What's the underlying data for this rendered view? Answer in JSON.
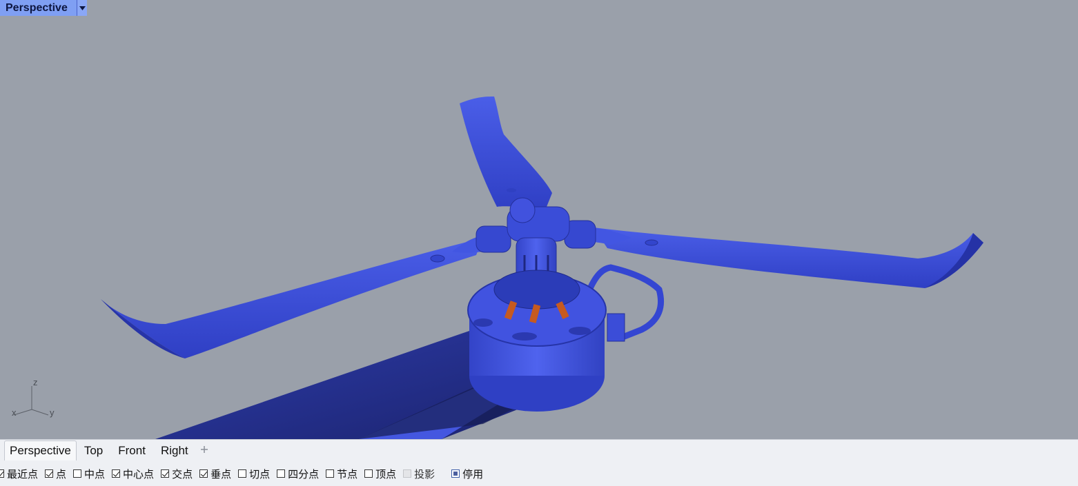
{
  "viewport": {
    "title": "Perspective",
    "dropdown_icon": "caret-down-icon",
    "background_color": "#9aa0aa",
    "model_color": "#3c4fd6",
    "axis_labels": {
      "z": "z",
      "x": "x",
      "y": "y"
    }
  },
  "tabs": [
    {
      "label": "Perspective",
      "active": true
    },
    {
      "label": "Top",
      "active": false
    },
    {
      "label": "Front",
      "active": false
    },
    {
      "label": "Right",
      "active": false
    }
  ],
  "tab_add_icon": "plus-icon",
  "snaps": [
    {
      "label": "最近点",
      "checked": true
    },
    {
      "label": "点",
      "checked": true
    },
    {
      "label": "中点",
      "checked": false
    },
    {
      "label": "中心点",
      "checked": true
    },
    {
      "label": "交点",
      "checked": true
    },
    {
      "label": "垂点",
      "checked": true
    },
    {
      "label": "切点",
      "checked": false
    },
    {
      "label": "四分点",
      "checked": false
    },
    {
      "label": "节点",
      "checked": false
    },
    {
      "label": "顶点",
      "checked": false
    },
    {
      "label": "投影",
      "checked": false,
      "disabled": true
    },
    {
      "label": "停用",
      "checked": "partial"
    }
  ]
}
